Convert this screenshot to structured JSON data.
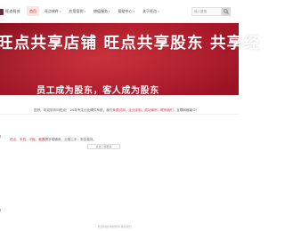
{
  "header": {
    "logo_text": "旺点科技",
    "nav": [
      {
        "label": "首页",
        "has_dropdown": false,
        "active": true
      },
      {
        "label": "旺点软件",
        "has_dropdown": true,
        "active": false
      },
      {
        "label": "应用案例",
        "has_dropdown": true,
        "active": false
      },
      {
        "label": "增值服务",
        "has_dropdown": true,
        "active": false
      },
      {
        "label": "帮助中心",
        "has_dropdown": true,
        "active": false
      },
      {
        "label": "关于旺点",
        "has_dropdown": true,
        "active": false
      }
    ],
    "search_placeholder": "输入要搜"
  },
  "banner": {
    "headline": "旺点共享店铺  旺点共享股东  共享经",
    "tagline": "员工成为股东，客人成为股东"
  },
  "notice": {
    "prefix": "您好，欢迎您访问旺点！ 20年专注行业硬件系统，我们",
    "link1": "免费试用",
    "mid1": "，",
    "link2": "企业定制",
    "mid2": "，",
    "link3": "成功案例",
    "mid3": "，",
    "link4": "联系我们",
    "suffix": "，互联网赋能中！"
  },
  "content": {
    "para_hl": "旺点、手机、平板、触摸屏",
    "para_rest": "多端通用，云端上手，安全高效。",
    "more_label": "点击了解更多"
  },
  "footer": {
    "text": "旺点科技 版权所有  联系我们"
  },
  "colors": {
    "accent": "#c2272d",
    "banner": "#9a1224",
    "active_nav_bg": "#fde5e5"
  }
}
